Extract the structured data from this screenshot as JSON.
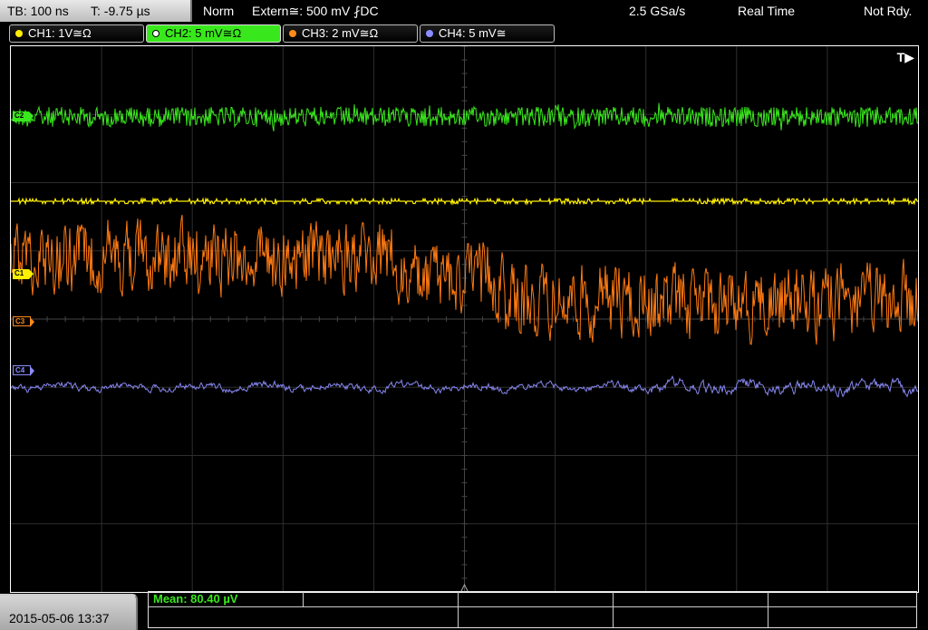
{
  "status_bar": {
    "timebase": "TB: 100 ns",
    "trigger_time": "T: -9.75 µs",
    "acq_mode": "Norm",
    "trigger_source": "Extern≅: 500 mV ⨏DC",
    "sample_rate": "2.5 GSa/s",
    "mode": "Real Time",
    "state": "Not Rdy."
  },
  "channels": [
    {
      "label": "CH1: 1V≅Ω",
      "color": "#ffef00",
      "active": false
    },
    {
      "label": "CH2: 5 mV≅Ω",
      "color": "#39e81c",
      "active": true
    },
    {
      "label": "CH3: 2 mV≅Ω",
      "color": "#ff8a1a",
      "active": false
    },
    {
      "label": "CH4: 5 mV≅",
      "color": "#8a8cff",
      "active": false
    }
  ],
  "trigger_marker": "T▶",
  "markers": {
    "c2": "C2",
    "c1": "C1",
    "c3": "C3",
    "c4": "C4"
  },
  "waveform_colors": {
    "ch1": "#ffef00",
    "ch2": "#39e81c",
    "ch3": "#ff7a12",
    "ch4": "#8686f0"
  },
  "measurement": {
    "mean": "Mean: 80.40 µV"
  },
  "datetime": "2015-05-06 13:37"
}
